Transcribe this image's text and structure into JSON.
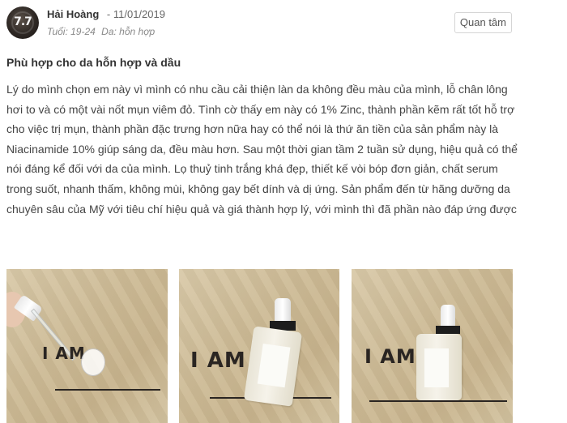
{
  "review": {
    "avatar_score": "7.7",
    "user_name": "Hải Hoàng",
    "date": "- 11/01/2019",
    "age": "Tuổi: 19-24",
    "skin_type": "Da: hỗn hợp",
    "follow_label": "Quan tâm",
    "title": "Phù hợp cho da hỗn hợp và dầu",
    "body": "Lý do mình chọn em này vì mình có nhu cầu cải thiện làn da không đều màu của mình, lỗ chân lông hơi to và có một vài nốt mụn viêm đỏ. Tình cờ thấy em này có 1% Zinc, thành phần kẽm rất tốt hỗ trợ cho việc trị mụn, thành phần đặc trưng hơn nữa hay có thể nói là thứ ăn tiền của sản phẩm này là Niacinamide 10% giúp sáng da, đều màu hơn. Sau một thời gian tầm 2 tuần sử dụng, hiệu quả có thể nói đáng kể đối với da của mình. Lọ thuỷ tinh trắng khá đẹp, thiết kế vòi bóp đơn giản, chất serum trong suốt, nhanh thấm, không mùi, không gay bết dính và dị ứng. Sản phẩm đến từ hãng dưỡng da chuyên sâu của Mỹ với tiêu chí hiệu quả và giá thành hợp lý, với mình thì đã phần nào đáp ứng được"
  },
  "photos": [
    {
      "text": "I AM"
    },
    {
      "text": "I AM"
    },
    {
      "text": "I AM"
    }
  ]
}
